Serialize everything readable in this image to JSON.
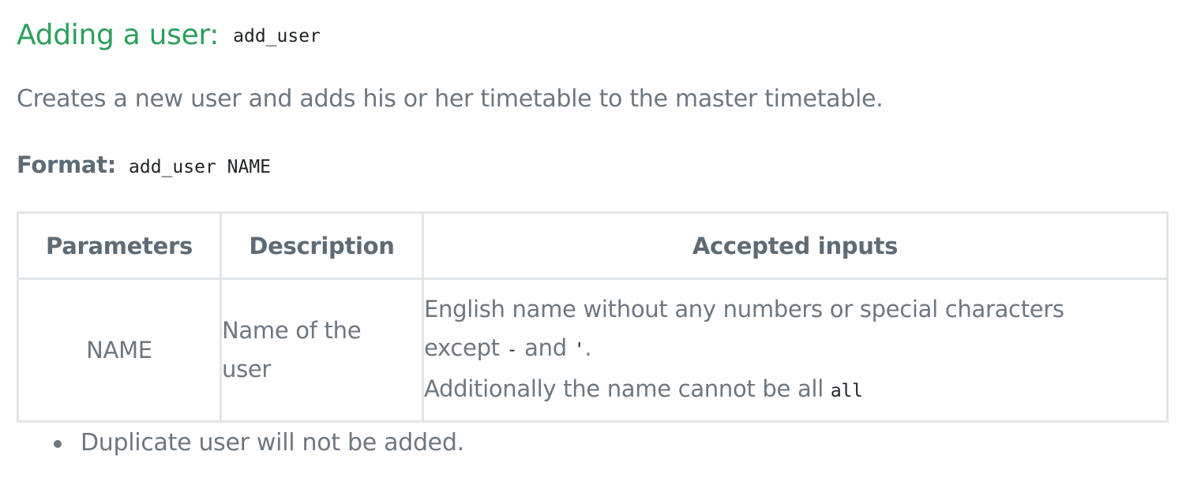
{
  "section": {
    "title": "Adding a user:",
    "command": "add_user",
    "description": "Creates a new user and adds his or her timetable to the master timetable.",
    "format_label": "Format:",
    "format_code": "add_user NAME"
  },
  "table": {
    "headers": [
      "Parameters",
      "Description",
      "Accepted inputs"
    ],
    "rows": [
      {
        "parameter": "NAME",
        "description_line1": "Name of the",
        "description_line2": "user",
        "accepted_line1": "English name without any numbers or special characters",
        "accepted_line2_prefix": "except",
        "accepted_code_dash": "-",
        "accepted_line2_and": "and",
        "accepted_code_quote": "'",
        "accepted_line2_end": ".",
        "accepted_line3_prefix": "Additionally the name cannot be all",
        "accepted_code_all": "all"
      }
    ]
  },
  "notes": [
    "Duplicate user will not be added."
  ],
  "colors": {
    "heading_green": "#2e9e5b",
    "text_gray": "#6d7780",
    "border_gray": "#e2e5e7",
    "code_dark": "#1f2328"
  }
}
